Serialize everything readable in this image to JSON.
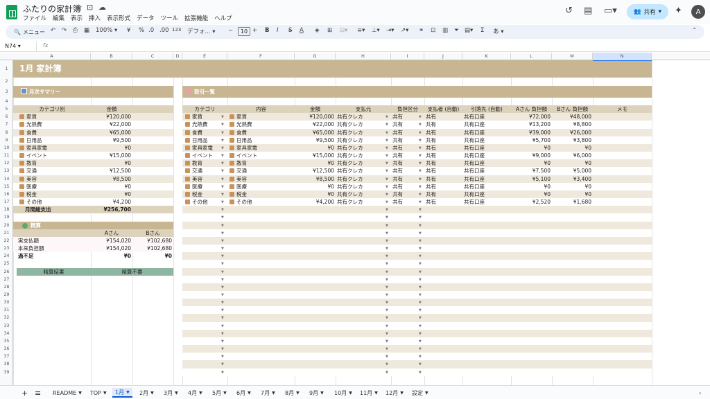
{
  "title": "ふたりの家計簿",
  "menu": [
    "ファイル",
    "編集",
    "表示",
    "挿入",
    "表示形式",
    "データ",
    "ツール",
    "拡張機能",
    "ヘルプ"
  ],
  "share_label": "共有",
  "avatar": "A",
  "toolbar": {
    "menu_search": "メニュー",
    "zoom": "100%",
    "currency": "¥",
    "percent": "%",
    "decrease_decimal": ".0",
    "increase_decimal": ".00",
    "number_format": "123",
    "font": "デフォ...",
    "font_size": "10",
    "bold": "B",
    "italic": "I",
    "input_tools": "あ"
  },
  "name_box": "N74",
  "fx": "fx",
  "columns": [
    "A",
    "B",
    "C",
    "D",
    "E",
    "F",
    "G",
    "H",
    "I",
    "J",
    "K",
    "L",
    "M",
    "N"
  ],
  "selected_column": "N",
  "rows": [
    "1",
    "2",
    "3",
    "4",
    "5",
    "6",
    "7",
    "8",
    "9",
    "10",
    "11",
    "12",
    "13",
    "14",
    "15",
    "16",
    "17",
    "18",
    "19",
    "20",
    "21",
    "22",
    "23",
    "24",
    "25",
    "26",
    "27",
    "28",
    "29",
    "30",
    "31",
    "32",
    "33",
    "34",
    "35",
    "36",
    "37",
    "38",
    "39"
  ],
  "sheet_title": "1月 家計簿",
  "summary": {
    "title": "月次サマリー",
    "col_category": "カテゴリ別",
    "col_amount": "金額",
    "rows": [
      {
        "cat": "家賃",
        "amt": "¥120,000"
      },
      {
        "cat": "光熱費",
        "amt": "¥22,000"
      },
      {
        "cat": "食費",
        "amt": "¥65,000"
      },
      {
        "cat": "日用品",
        "amt": "¥9,500"
      },
      {
        "cat": "家具家電",
        "amt": "¥0"
      },
      {
        "cat": "イベント",
        "amt": "¥15,000"
      },
      {
        "cat": "教育",
        "amt": "¥0"
      },
      {
        "cat": "交通",
        "amt": "¥12,500"
      },
      {
        "cat": "美容",
        "amt": "¥8,500"
      },
      {
        "cat": "医療",
        "amt": "¥0"
      },
      {
        "cat": "税金",
        "amt": "¥0"
      },
      {
        "cat": "その他",
        "amt": "¥4,200"
      }
    ],
    "total_label": "月間総支出",
    "total_value": "¥256,700"
  },
  "settlement": {
    "title": "精算",
    "col_a": "Aさん",
    "col_b": "Bさん",
    "rows": [
      {
        "label": "実支払額",
        "a": "¥154,020",
        "b": "¥102,680"
      },
      {
        "label": "本来負担額",
        "a": "¥154,020",
        "b": "¥102,680"
      },
      {
        "label": "過不足",
        "a": "¥0",
        "b": "¥0"
      }
    ],
    "result_label": "精算結果",
    "result_value": "精算不要"
  },
  "transactions": {
    "title": "取引一覧",
    "headers": [
      "カテゴリ",
      "内容",
      "金額",
      "支払元",
      "負担区分",
      "支払者 (自動)",
      "引落先 (自動)",
      "Aさん 負担額",
      "Bさん 負担額",
      "メモ"
    ],
    "rows": [
      {
        "cat": "家賃",
        "desc": "家賃",
        "amt": "¥120,000",
        "src": "共有クレカ",
        "share": "共有",
        "payer": "共有",
        "acct": "共有口座",
        "a": "¥72,000",
        "b": "¥48,000"
      },
      {
        "cat": "光熱費",
        "desc": "光熱費",
        "amt": "¥22,000",
        "src": "共有クレカ",
        "share": "共有",
        "payer": "共有",
        "acct": "共有口座",
        "a": "¥13,200",
        "b": "¥8,800"
      },
      {
        "cat": "食費",
        "desc": "食費",
        "amt": "¥65,000",
        "src": "共有クレカ",
        "share": "共有",
        "payer": "共有",
        "acct": "共有口座",
        "a": "¥39,000",
        "b": "¥26,000"
      },
      {
        "cat": "日用品",
        "desc": "日用品",
        "amt": "¥9,500",
        "src": "共有クレカ",
        "share": "共有",
        "payer": "共有",
        "acct": "共有口座",
        "a": "¥5,700",
        "b": "¥3,800"
      },
      {
        "cat": "家具家電",
        "desc": "家具家電",
        "amt": "¥0",
        "src": "共有クレカ",
        "share": "共有",
        "payer": "共有",
        "acct": "共有口座",
        "a": "¥0",
        "b": "¥0"
      },
      {
        "cat": "イベント",
        "desc": "イベント",
        "amt": "¥15,000",
        "src": "共有クレカ",
        "share": "共有",
        "payer": "共有",
        "acct": "共有口座",
        "a": "¥9,000",
        "b": "¥6,000"
      },
      {
        "cat": "教育",
        "desc": "教育",
        "amt": "¥0",
        "src": "共有クレカ",
        "share": "共有",
        "payer": "共有",
        "acct": "共有口座",
        "a": "¥0",
        "b": "¥0"
      },
      {
        "cat": "交通",
        "desc": "交通",
        "amt": "¥12,500",
        "src": "共有クレカ",
        "share": "共有",
        "payer": "共有",
        "acct": "共有口座",
        "a": "¥7,500",
        "b": "¥5,000"
      },
      {
        "cat": "美容",
        "desc": "美容",
        "amt": "¥8,500",
        "src": "共有クレカ",
        "share": "共有",
        "payer": "共有",
        "acct": "共有口座",
        "a": "¥5,100",
        "b": "¥3,400"
      },
      {
        "cat": "医療",
        "desc": "医療",
        "amt": "¥0",
        "src": "共有クレカ",
        "share": "共有",
        "payer": "共有",
        "acct": "共有口座",
        "a": "¥0",
        "b": "¥0"
      },
      {
        "cat": "税金",
        "desc": "税金",
        "amt": "¥0",
        "src": "共有クレカ",
        "share": "共有",
        "payer": "共有",
        "acct": "共有口座",
        "a": "¥0",
        "b": "¥0"
      },
      {
        "cat": "その他",
        "desc": "その他",
        "amt": "¥4,200",
        "src": "共有クレカ",
        "share": "共有",
        "payer": "共有",
        "acct": "共有口座",
        "a": "¥2,520",
        "b": "¥1,680"
      }
    ]
  },
  "category_icons": [
    "house-icon",
    "lightbulb-icon",
    "food-icon",
    "basket-icon",
    "sofa-icon",
    "event-icon",
    "book-icon",
    "train-icon",
    "lipstick-icon",
    "hospital-icon",
    "money-bag-icon",
    "pin-icon"
  ],
  "sheet_tabs": [
    "README",
    "TOP",
    "1月",
    "2月",
    "3月",
    "4月",
    "5月",
    "6月",
    "7月",
    "8月",
    "9月",
    "10月",
    "11月",
    "12月",
    "設定"
  ],
  "active_tab": "1月",
  "colors": {
    "tan": "#c8b692",
    "tan_light": "#d9ccb0",
    "stripe": "#efe9dd",
    "header_row": "#ddd2bc",
    "green": "#8fb5a3",
    "blue_sel": "#d3e3fd",
    "brand": "#0f9d58"
  }
}
